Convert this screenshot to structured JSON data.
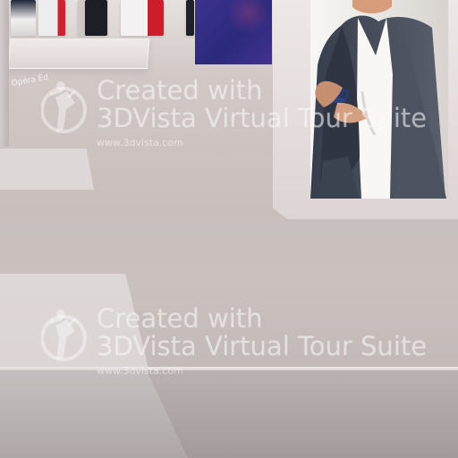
{
  "viewer": {
    "wall_label": "Opéra Éd",
    "watermarks": [
      {
        "line1": "Created with",
        "line2": "3DVista Virtual Tour Suite",
        "url": "www.3dvista.com"
      },
      {
        "line1": "Created with",
        "line2": "3DVista Virtual Tour Suite",
        "url": "www.3dvista.com"
      }
    ],
    "icons": {
      "watermark": "3dvista-logo-icon"
    },
    "colors": {
      "accent_red": "#d3202d",
      "poster_blue": "#253a7b",
      "purple_panel": "#3e328e"
    }
  }
}
